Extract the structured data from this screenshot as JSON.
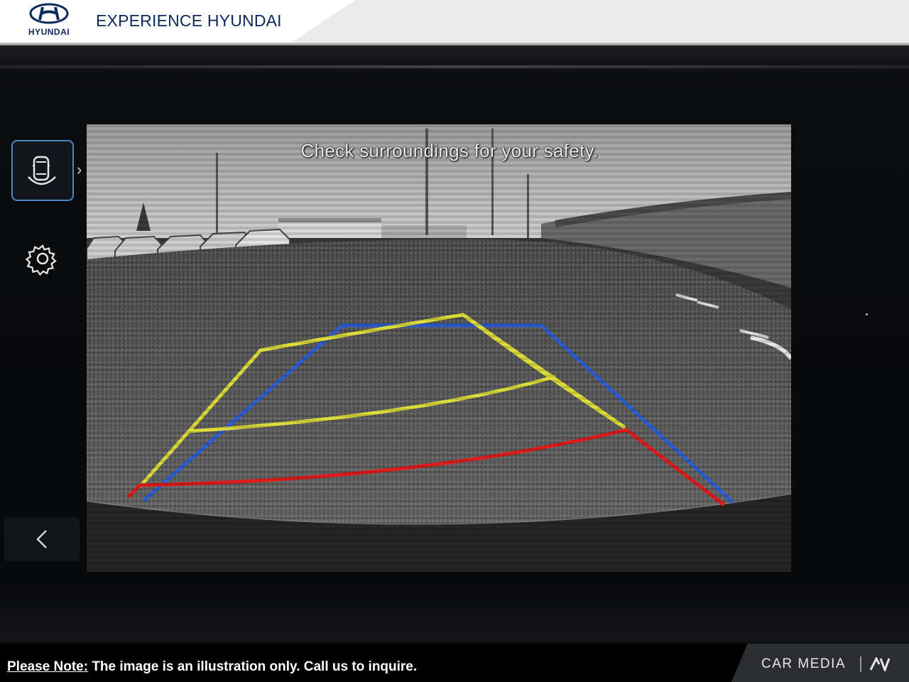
{
  "banner": {
    "brand": "HYUNDAI",
    "dealer": "EXPERIENCE HYUNDAI",
    "brand_color": "#0b2a5b"
  },
  "sidebar": {
    "items": [
      {
        "icon": "parking-view-icon",
        "selected": true
      },
      {
        "icon": "gear-icon",
        "selected": false
      },
      {
        "icon": "back-arrow-icon",
        "selected": false
      }
    ],
    "accent": "#4a87c9"
  },
  "camera": {
    "message": "Check surroundings for your safety.",
    "guide_colors": {
      "yellow": "#dcdc3a",
      "blue": "#2a5fd6",
      "red": "#e01c1c"
    }
  },
  "footer": {
    "note_label": "Please Note:",
    "note_text": " The image is an illustration only. Call us to inquire.",
    "brand": "CAR MEDIA"
  }
}
